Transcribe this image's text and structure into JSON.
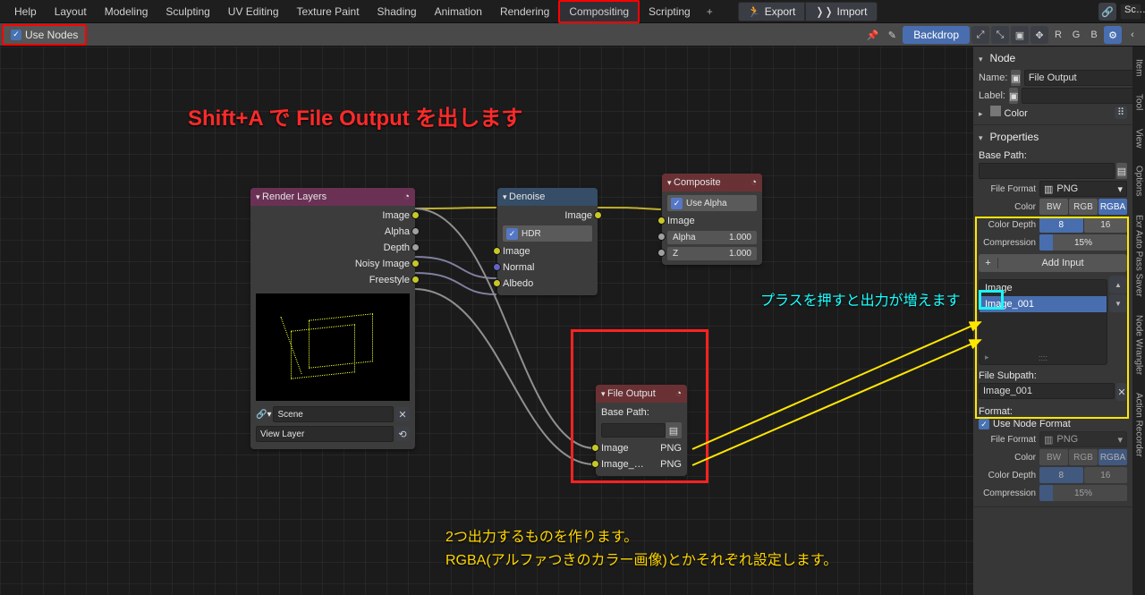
{
  "menu": [
    "Help",
    "Layout",
    "Modeling",
    "Sculpting",
    "UV Editing",
    "Texture Paint",
    "Shading",
    "Animation",
    "Rendering",
    "Compositing",
    "Scripting"
  ],
  "export_btn": "Export",
  "import_btn": "Import",
  "scene_dropdown": "Sc…",
  "use_nodes": "Use Nodes",
  "backdrop": "Backdrop",
  "letter_btns": [
    "R",
    "G",
    "B"
  ],
  "anno_top": "Shift+A で File Output を出します",
  "anno_add": "プラスを押すと出力が増えます",
  "anno_bottom1": "2つ出力するものを作ります。",
  "anno_bottom2": "RGBA(アルファつきのカラー画像)とかそれぞれ設定します。",
  "nodes": {
    "render": {
      "title": "Render Layers",
      "outs": [
        "Image",
        "Alpha",
        "Depth",
        "Noisy Image",
        "Freestyle"
      ],
      "scene": "Scene",
      "viewlayer": "View Layer"
    },
    "denoise": {
      "title": "Denoise",
      "out": "Image",
      "hdr": "HDR",
      "ins": [
        "Image",
        "Normal",
        "Albedo"
      ]
    },
    "composite": {
      "title": "Composite",
      "usealpha": "Use Alpha",
      "ins": [
        "Image",
        "Alpha",
        "Z"
      ],
      "vals": [
        "",
        "1.000",
        "1.000"
      ]
    },
    "fileout": {
      "title": "File Output",
      "basepath": "Base Path:",
      "slots": [
        {
          "name": "Image",
          "fmt": "PNG"
        },
        {
          "name": "Image_…",
          "fmt": "PNG"
        }
      ]
    }
  },
  "panel": {
    "node_header": "Node",
    "name_lbl": "Name:",
    "name_val": "File Output",
    "label_lbl": "Label:",
    "color_sub": "Color",
    "props_header": "Properties",
    "basepath": "Base Path:",
    "fileformat_lbl": "File Format",
    "fileformat_val": "PNG",
    "color_lbl": "Color",
    "color_opts": [
      "BW",
      "RGB",
      "RGBA"
    ],
    "depth_lbl": "Color Depth",
    "depth_opts": [
      "8",
      "16"
    ],
    "comp_lbl": "Compression",
    "comp_val": "15%",
    "add_input": "Add Input",
    "list": [
      "Image",
      "Image_001"
    ],
    "file_subpath_lbl": "File Subpath:",
    "file_subpath_val": "Image_001",
    "format_lbl": "Format:",
    "use_node_fmt": "Use Node Format",
    "fmt2_color": [
      "BW",
      "RGB",
      "RGBA"
    ],
    "fmt2_depth": [
      "8",
      "16"
    ],
    "fmt2_comp": "15%"
  },
  "vtabs": [
    "Item",
    "Tool",
    "View",
    "Options",
    "Exr Auto Pass Saver",
    "Node Wrangler",
    "Action Recorder"
  ]
}
